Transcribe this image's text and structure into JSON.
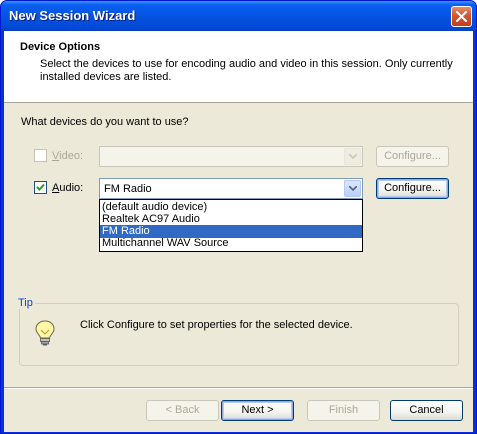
{
  "window": {
    "title": "New Session Wizard"
  },
  "header": {
    "title": "Device Options",
    "description": "Select the devices to use for encoding audio and video in this session. Only currently installed devices are listed."
  },
  "question": "What devices do you want to use?",
  "video": {
    "label": "Video:",
    "checked": false,
    "enabled": false,
    "selected": "",
    "configure_label": "Configure..."
  },
  "audio": {
    "label": "Audio:",
    "checked": true,
    "enabled": true,
    "selected": "FM Radio",
    "configure_label": "Configure...",
    "options": [
      "(default audio device)",
      "Realtek AC97 Audio",
      "FM Radio",
      "Multichannel WAV Source"
    ],
    "highlighted_option": "FM Radio"
  },
  "tip": {
    "legend": "Tip",
    "text": "Click Configure to set properties for the selected device.",
    "icon": "lightbulb-icon"
  },
  "buttons": {
    "back": "< Back",
    "next": "Next >",
    "finish": "Finish",
    "cancel": "Cancel"
  },
  "colors": {
    "titlebar": "#0554e3",
    "selection": "#316ac5",
    "dialog_bg": "#ece9d8",
    "close_button": "#d5552c"
  }
}
